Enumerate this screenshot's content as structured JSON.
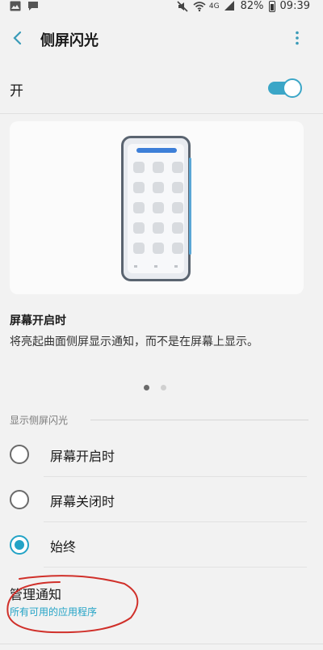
{
  "status_bar": {
    "battery": "82%",
    "time": "09:39",
    "network": "4G"
  },
  "header": {
    "title": "侧屏闪光"
  },
  "master_switch": {
    "label": "开",
    "on": true
  },
  "preview": {
    "title": "屏幕开启时",
    "description": "将亮起曲面侧屏显示通知，而不是在屏幕上显示。",
    "page_index": 1,
    "page_count": 2
  },
  "display_section": {
    "header": "显示侧屏闪光",
    "options": [
      {
        "label": "屏幕开启时",
        "selected": false
      },
      {
        "label": "屏幕关闭时",
        "selected": false
      },
      {
        "label": "始终",
        "selected": true
      }
    ]
  },
  "manage": {
    "title": "管理通知",
    "subtitle": "所有可用的应用程序"
  },
  "colors": {
    "accent": "#23a3c6",
    "annotation": "#d0302a"
  }
}
